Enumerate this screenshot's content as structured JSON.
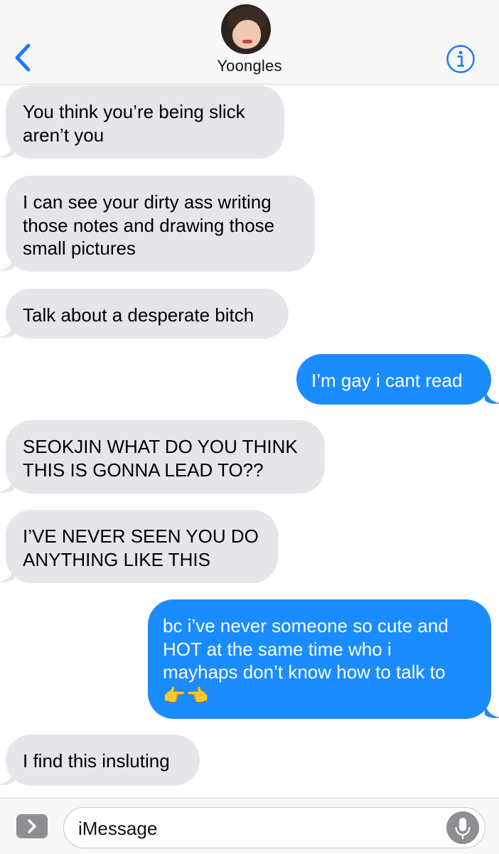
{
  "header": {
    "contact_name": "Yoongles",
    "back_icon": "chevron-left-icon",
    "info_icon": "info-icon",
    "accent_color": "#1a7cf5"
  },
  "messages": [
    {
      "direction": "incoming",
      "text": "You think you’re being slick\naren’t you"
    },
    {
      "direction": "incoming",
      "text": "I can see your dirty ass writing\nthose notes and drawing those\nsmall pictures"
    },
    {
      "direction": "incoming",
      "text": "Talk about a desperate bitch"
    },
    {
      "direction": "outgoing",
      "text": "I’m gay i cant read"
    },
    {
      "direction": "incoming",
      "text": "SEOKJIN WHAT DO YOU THINK\nTHIS IS GONNA LEAD TO??"
    },
    {
      "direction": "incoming",
      "text": "I’VE NEVER SEEN YOU DO\nANYTHING LIKE THIS"
    },
    {
      "direction": "outgoing",
      "text": "bc i’ve never someone so cute and\nHOT at the same time who i\nmayhaps don’t know how to talk to\n👉👈"
    },
    {
      "direction": "incoming",
      "text": "I find this insluting"
    }
  ],
  "colors": {
    "incoming_bubble": "#e5e5ea",
    "outgoing_bubble": "#1a8cff"
  },
  "input": {
    "placeholder": "iMessage",
    "expand_icon": "chevron-right-icon",
    "mic_icon": "microphone-icon"
  }
}
